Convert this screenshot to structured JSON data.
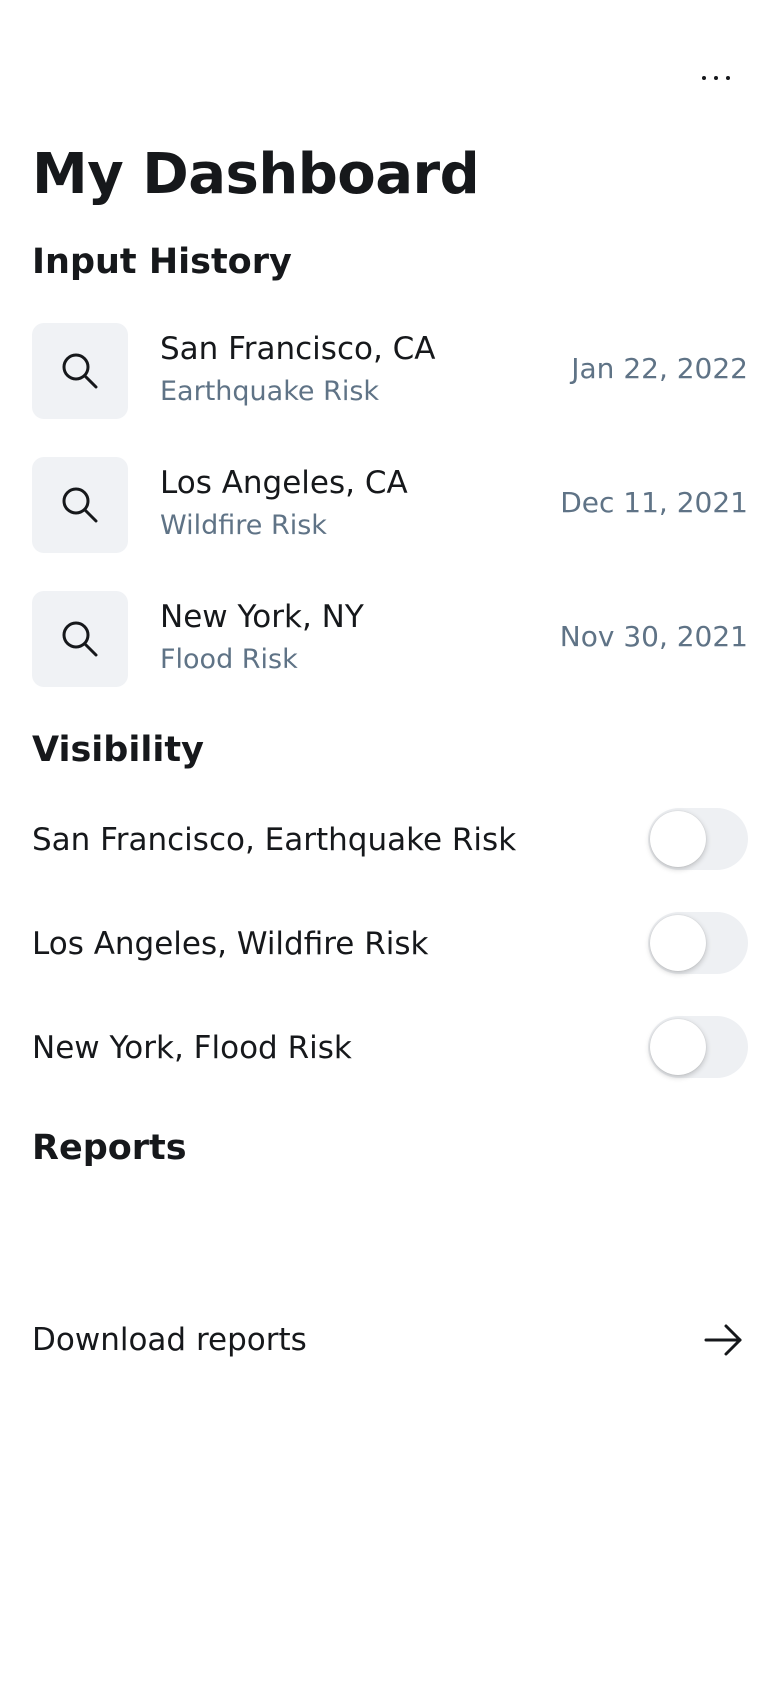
{
  "header": {
    "more_icon": "more-horizontal-icon",
    "title": "My Dashboard"
  },
  "input_history": {
    "title": "Input History",
    "icon": "search-icon",
    "items": [
      {
        "city": "San Francisco, CA",
        "risk": "Earthquake Risk",
        "date": "Jan 22, 2022"
      },
      {
        "city": "Los Angeles, CA",
        "risk": "Wildfire Risk",
        "date": "Dec 11, 2021"
      },
      {
        "city": "New York, NY",
        "risk": "Flood Risk",
        "date": "Nov 30, 2021"
      }
    ]
  },
  "visibility": {
    "title": "Visibility",
    "items": [
      {
        "label": "San Francisco, Earthquake Risk",
        "enabled": false
      },
      {
        "label": "Los Angeles, Wildfire Risk",
        "enabled": false
      },
      {
        "label": "New York, Flood Risk",
        "enabled": false
      }
    ]
  },
  "reports": {
    "title": "Reports",
    "download_label": "Download reports",
    "arrow_icon": "arrow-right-icon"
  },
  "colors": {
    "text_primary": "#16181b",
    "text_secondary": "#5f7386",
    "icon_box_bg": "#f0f2f5",
    "toggle_track_off": "#eef0f3"
  }
}
